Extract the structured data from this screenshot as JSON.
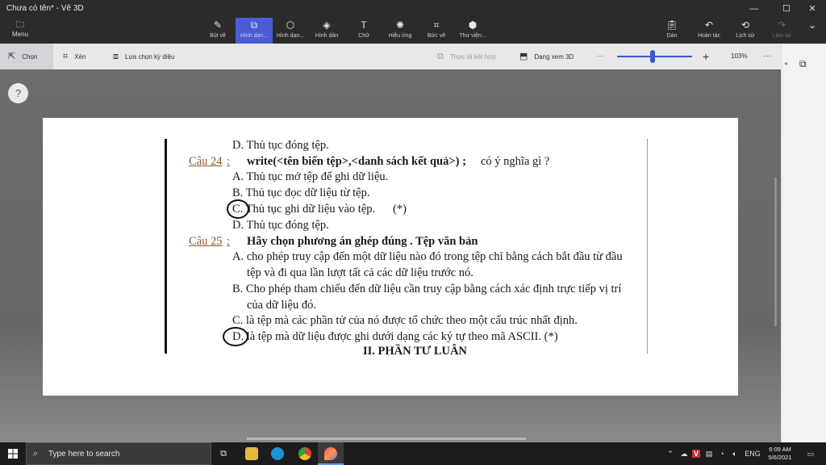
{
  "window": {
    "title": "Chưa có tên* - Vẽ 3D",
    "minimize": "—",
    "maximize": "☐",
    "close": "✕"
  },
  "ribbon": {
    "menu": "Menu",
    "tools": [
      {
        "label": "Bút vẽ",
        "icon": "brush-icon"
      },
      {
        "label": "Hình dạn...",
        "icon": "2d-shapes-icon"
      },
      {
        "label": "Hình dạn...",
        "icon": "3d-shapes-icon"
      },
      {
        "label": "Hình dán",
        "icon": "stickers-icon"
      },
      {
        "label": "Chữ",
        "icon": "text-icon"
      },
      {
        "label": "Hiệu ứng",
        "icon": "effects-icon"
      },
      {
        "label": "Bức vẽ",
        "icon": "canvas-icon"
      },
      {
        "label": "Thư viện...",
        "icon": "library-icon"
      }
    ],
    "right_tools": [
      {
        "label": "Dán",
        "icon": "paste-icon"
      },
      {
        "label": "Hoàn tác",
        "icon": "undo-icon"
      },
      {
        "label": "Lịch sử",
        "icon": "history-icon"
      },
      {
        "label": "Làm lại",
        "icon": "redo-icon"
      }
    ]
  },
  "toolbar": {
    "select": "Chọn",
    "crop": "Xén",
    "magic_select": "Lựa chọn kỳ diệu",
    "mixed_reality": "Thực tế kết hợp",
    "view_3d": "Dạng xem 3D",
    "zoom_minus": "—",
    "zoom_plus": "+",
    "zoom": "103%",
    "more": "···",
    "zoom_fraction": 0.47
  },
  "canvas": {
    "help": "?"
  },
  "document": {
    "line1": "D. Thủ tục đóng tệp.",
    "q24_label": "Câu 24",
    "q24_colon": ":",
    "q24_code": "write(<tên biến tệp>,<danh sách kết quả>) ;",
    "q24_text": "có ý nghĩa gì ?",
    "q24_a": "A. Thủ tục mở tệp để ghi dữ liệu.",
    "q24_b": "B. Thủ tục đọc dữ liệu từ tệp.",
    "q24_c": "C. Thủ tục ghi dữ liệu vào tệp.",
    "q24_c_mark": "(*)",
    "q24_d": "D. Thủ tục đóng tệp.",
    "q25_label": "Câu 25",
    "q25_colon": ":",
    "q25_text": "Hãy chọn phương án ghép đúng . Tệp văn bản",
    "q25_a1": "A. cho phép truy cập đến một dữ liệu nào đó trong tệp chỉ bằng cách bắt đầu từ đầu",
    "q25_a2": "tệp và đi qua lần lượt tất cả các dữ liệu trước nó.",
    "q25_b1": "B. Cho phép tham chiếu đến dữ liệu cần truy cập bằng cách xác định trực tiếp vị trí",
    "q25_b2": "của dữ liệu đó.",
    "q25_c": "C. là tệp mà các phần tử của nó được tổ chức theo một cấu trúc nhất định.",
    "q25_d": "D. là tệp mà dữ liệu được ghi dưới dạng các ký tự theo mã ASCII.  (*)",
    "section": "II. PHẦN TỰ LUẬN"
  },
  "taskbar": {
    "search_placeholder": "Type here to search",
    "language": "ENG",
    "time": "6:09 AM",
    "date": "5/6/2021"
  }
}
